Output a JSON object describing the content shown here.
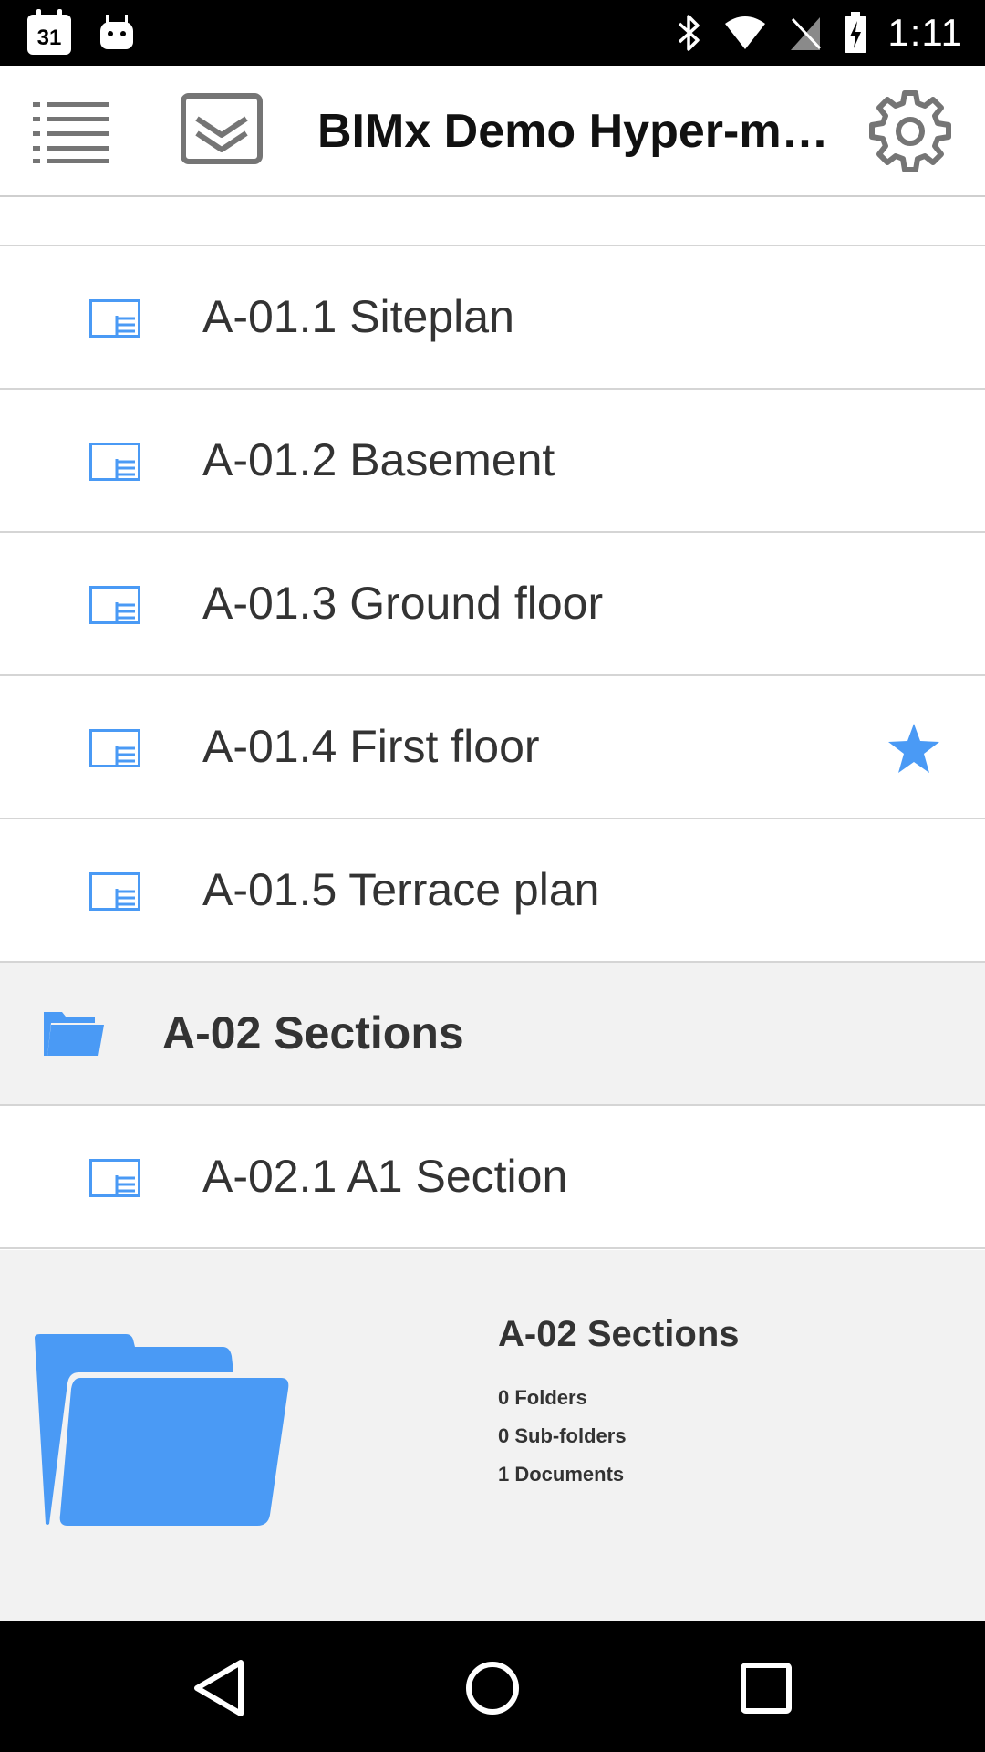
{
  "status_bar": {
    "time": "1:11",
    "calendar_day": "31",
    "icons": [
      "calendar-icon",
      "android-icon",
      "bluetooth-icon",
      "wifi-icon",
      "no-sim-icon",
      "battery-charging-icon"
    ]
  },
  "app_bar": {
    "title": "BIMx Demo Hyper-m…",
    "icons": [
      "menu-list-icon",
      "layers-icon",
      "settings-gear-icon"
    ]
  },
  "list": {
    "items": [
      {
        "type": "document",
        "label": "A-01.1 Siteplan",
        "favorite": false
      },
      {
        "type": "document",
        "label": "A-01.2 Basement",
        "favorite": false
      },
      {
        "type": "document",
        "label": "A-01.3 Ground floor",
        "favorite": false
      },
      {
        "type": "document",
        "label": "A-01.4 First floor",
        "favorite": true
      },
      {
        "type": "document",
        "label": "A-01.5 Terrace plan",
        "favorite": false
      },
      {
        "type": "folder",
        "label": "A-02 Sections"
      },
      {
        "type": "document",
        "label": "A-02.1 A1 Section",
        "favorite": false
      }
    ]
  },
  "details": {
    "title": "A-02 Sections",
    "folders": "0 Folders",
    "subfolders": "0 Sub-folders",
    "documents": "1 Documents"
  },
  "nav_bar": {
    "icons": [
      "back-icon",
      "home-icon",
      "recents-icon"
    ]
  },
  "colors": {
    "accent_blue": "#4a9af5",
    "icon_gray": "#757575",
    "text": "#333333",
    "selected_bg": "#f2f2f2"
  }
}
